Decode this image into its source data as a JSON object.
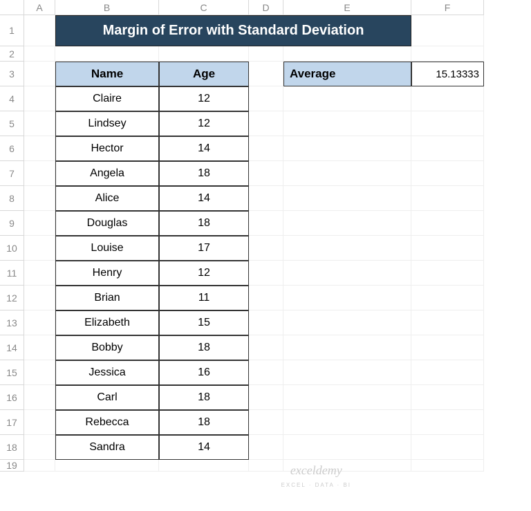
{
  "columns": [
    "A",
    "B",
    "C",
    "D",
    "E",
    "F"
  ],
  "rows": [
    "1",
    "2",
    "3",
    "4",
    "5",
    "6",
    "7",
    "8",
    "9",
    "10",
    "11",
    "12",
    "13",
    "14",
    "15",
    "16",
    "17",
    "18",
    "19"
  ],
  "title": "Margin of Error with Standard Deviation",
  "table": {
    "headers": {
      "name": "Name",
      "age": "Age"
    },
    "data": [
      {
        "name": "Claire",
        "age": "12"
      },
      {
        "name": "Lindsey",
        "age": "12"
      },
      {
        "name": "Hector",
        "age": "14"
      },
      {
        "name": "Angela",
        "age": "18"
      },
      {
        "name": "Alice",
        "age": "14"
      },
      {
        "name": "Douglas",
        "age": "18"
      },
      {
        "name": "Louise",
        "age": "17"
      },
      {
        "name": "Henry",
        "age": "12"
      },
      {
        "name": "Brian",
        "age": "11"
      },
      {
        "name": "Elizabeth",
        "age": "15"
      },
      {
        "name": "Bobby",
        "age": "18"
      },
      {
        "name": "Jessica",
        "age": "16"
      },
      {
        "name": "Carl",
        "age": "18"
      },
      {
        "name": "Rebecca",
        "age": "18"
      },
      {
        "name": "Sandra",
        "age": "14"
      }
    ]
  },
  "average": {
    "label": "Average",
    "value": "15.13333"
  },
  "watermark": {
    "main": "exceldemy",
    "sub": "EXCEL · DATA · BI"
  }
}
